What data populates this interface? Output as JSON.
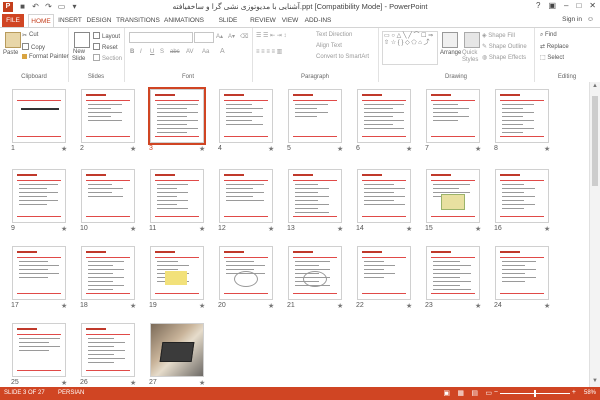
{
  "window": {
    "title": "آشنایی با مدیوتوزی نشی گرا و ساخفیافته.ppt [Compatibility Mode] - PowerPoint",
    "sign_in": "Sign in",
    "app_icon": "P"
  },
  "tabs": [
    {
      "label": "FILE"
    },
    {
      "label": "HOME"
    },
    {
      "label": "INSERT"
    },
    {
      "label": "DESIGN"
    },
    {
      "label": "TRANSITIONS"
    },
    {
      "label": "ANIMATIONS"
    },
    {
      "label": "SLIDE SHOW"
    },
    {
      "label": "REVIEW"
    },
    {
      "label": "VIEW"
    },
    {
      "label": "ADD-INS"
    }
  ],
  "ribbon": {
    "clipboard": {
      "label": "Clipboard",
      "paste": "Paste",
      "cut": "Cut",
      "copy": "Copy",
      "format_painter": "Format Painter"
    },
    "slides": {
      "label": "Slides",
      "new_slide": "New",
      "new_slide2": "Slide",
      "layout": "Layout",
      "reset": "Reset",
      "section": "Section"
    },
    "font": {
      "label": "Font",
      "bold": "B",
      "italic": "I",
      "underline": "U",
      "shadow": "S",
      "strike": "abc",
      "spacing": "AV",
      "case": "Aa"
    },
    "paragraph": {
      "label": "Paragraph",
      "text_direction": "Text Direction",
      "align_text": "Align Text",
      "convert_smartart": "Convert to SmartArt"
    },
    "drawing": {
      "label": "Drawing",
      "arrange": "Arrange",
      "quick_styles": "Quick",
      "quick_styles2": "Styles",
      "shape_fill": "Shape Fill",
      "shape_outline": "Shape Outline",
      "shape_effects": "Shape Effects"
    },
    "editing": {
      "label": "Editing",
      "find": "Find",
      "replace": "Replace",
      "select": "Select"
    }
  },
  "slides": [
    {
      "num": "1"
    },
    {
      "num": "2"
    },
    {
      "num": "3"
    },
    {
      "num": "4"
    },
    {
      "num": "5"
    },
    {
      "num": "6"
    },
    {
      "num": "7"
    },
    {
      "num": "8"
    },
    {
      "num": "9"
    },
    {
      "num": "10"
    },
    {
      "num": "11"
    },
    {
      "num": "12"
    },
    {
      "num": "13"
    },
    {
      "num": "14"
    },
    {
      "num": "15"
    },
    {
      "num": "16"
    },
    {
      "num": "17"
    },
    {
      "num": "18"
    },
    {
      "num": "19"
    },
    {
      "num": "20"
    },
    {
      "num": "21"
    },
    {
      "num": "22"
    },
    {
      "num": "23"
    },
    {
      "num": "24"
    },
    {
      "num": "25"
    },
    {
      "num": "26"
    },
    {
      "num": "27"
    }
  ],
  "selected_slide": 3,
  "status": {
    "slide_info": "SLIDE 3 OF 27",
    "language": "PERSIAN",
    "zoom": "58%"
  },
  "colors": {
    "accent": "#d04523",
    "slide_rule": "#e04a48"
  }
}
